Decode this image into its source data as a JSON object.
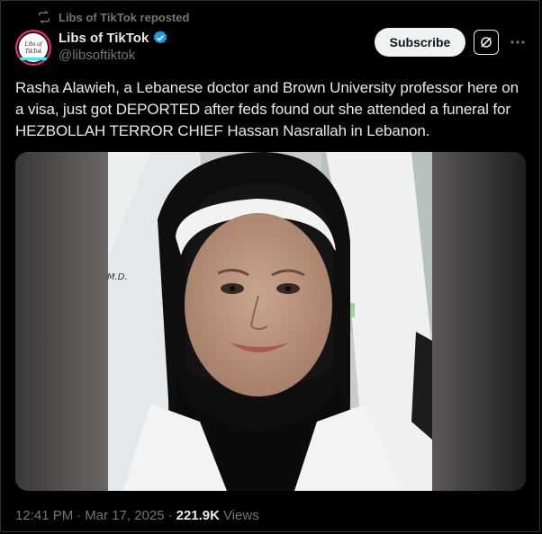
{
  "repost": {
    "text": "Libs of TikTok reposted",
    "icon": "repost-icon"
  },
  "author": {
    "name": "Libs of TikTok",
    "handle": "@libsoftiktok",
    "avatar_text_1": "Libs of",
    "avatar_text_2": "TikTok",
    "verified": true,
    "verified_color": "#1d9bf0"
  },
  "actions": {
    "subscribe_label": "Subscribe",
    "grok_icon": "grok-icon",
    "more_icon": "more-icon"
  },
  "post": {
    "text": "Rasha Alawieh, a Lebanese doctor and Brown University professor here on a visa, just got DEPORTED after feds found out she attended a funeral for HEZBOLLAH TERROR CHIEF Hassan Nasrallah in Lebanon.",
    "coat_name": "M.D."
  },
  "meta": {
    "time": "12:41 PM",
    "date": "Mar 17, 2025",
    "views_count": "221.9K",
    "views_label": "Views"
  },
  "colors": {
    "background": "#000000",
    "text": "#e7e9ea",
    "muted": "#71767b",
    "accent": "#1d9bf0"
  }
}
